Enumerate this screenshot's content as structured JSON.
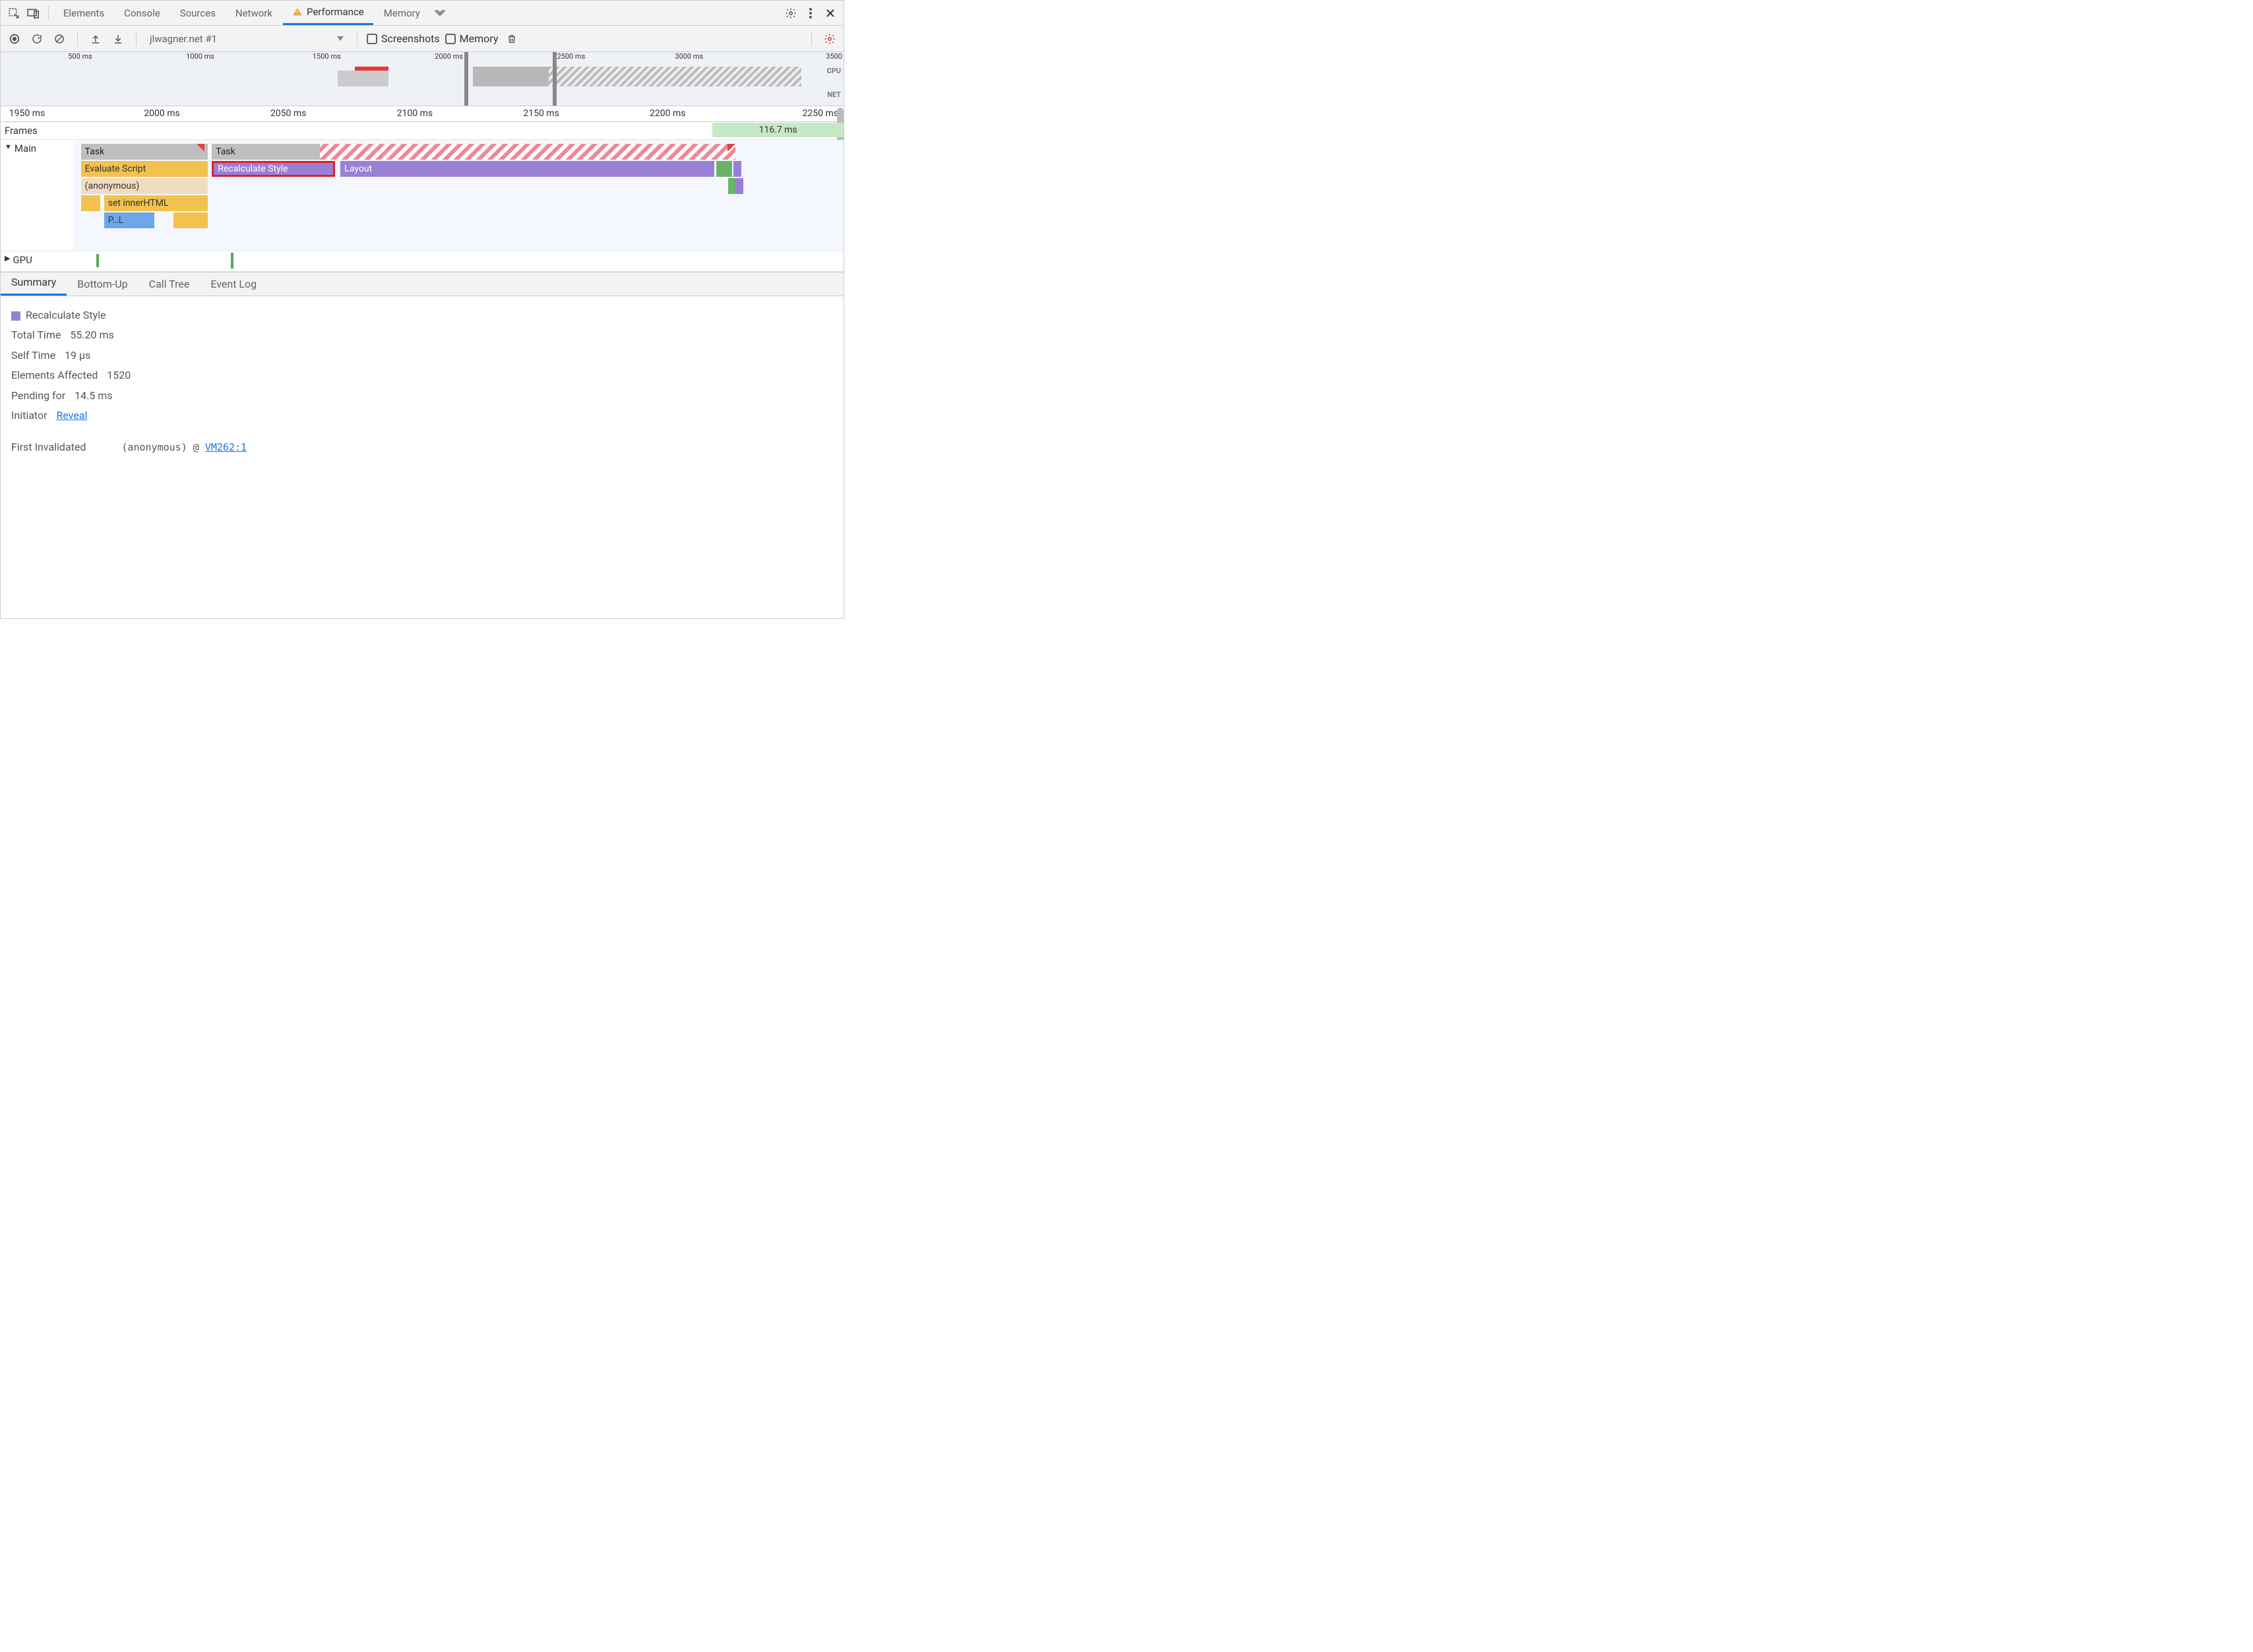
{
  "panels": {
    "elements": "Elements",
    "console": "Console",
    "sources": "Sources",
    "network": "Network",
    "performance": "Performance",
    "memory": "Memory"
  },
  "toolbar": {
    "recording_select": "jlwagner.net #1",
    "screenshots": "Screenshots",
    "memory": "Memory"
  },
  "overview_ticks": [
    "500 ms",
    "1000 ms",
    "1500 ms",
    "2000 ms",
    "2500 ms",
    "3000 ms",
    "3500"
  ],
  "overview_lanes": {
    "cpu": "CPU",
    "net": "NET"
  },
  "zoom_ticks": [
    "1950 ms",
    "2000 ms",
    "2050 ms",
    "2100 ms",
    "2150 ms",
    "2200 ms",
    "2250 ms"
  ],
  "tracks": {
    "frames": {
      "label": "Frames",
      "frame_duration": "116.7 ms"
    },
    "main": {
      "label": "Main",
      "bars": {
        "task1": "Task",
        "task2": "Task",
        "eval": "Evaluate Script",
        "anon": "(anonymous)",
        "inner": "set innerHTML",
        "parse": "P…L",
        "recalc": "Recalculate Style",
        "layout": "Layout"
      }
    },
    "gpu": {
      "label": "GPU"
    }
  },
  "detail_tabs": [
    "Summary",
    "Bottom-Up",
    "Call Tree",
    "Event Log"
  ],
  "summary": {
    "title": "Recalculate Style",
    "total_time_label": "Total Time",
    "total_time_value": "55.20 ms",
    "self_time_label": "Self Time",
    "self_time_value": "19 µs",
    "elements_affected_label": "Elements Affected",
    "elements_affected_value": "1520",
    "pending_for_label": "Pending for",
    "pending_for_value": "14.5 ms",
    "initiator_label": "Initiator",
    "initiator_link": "Reveal",
    "first_invalidated_label": "First Invalidated",
    "first_invalidated_fn": "(anonymous)",
    "first_invalidated_at": "@",
    "first_invalidated_loc": "VM262:1"
  }
}
